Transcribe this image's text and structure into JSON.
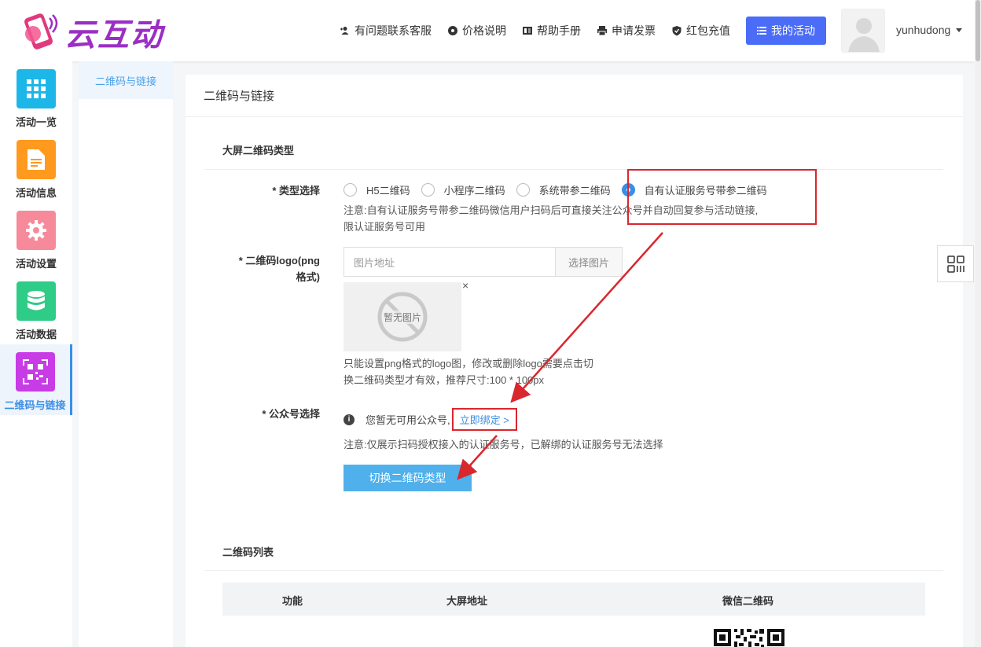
{
  "header": {
    "logo_text": "云互动",
    "nav": [
      {
        "label": "有问题联系客服",
        "icon": "user-plus-icon"
      },
      {
        "label": "价格说明",
        "icon": "gear-badge-icon"
      },
      {
        "label": "帮助手册",
        "icon": "book-icon"
      },
      {
        "label": "申请发票",
        "icon": "printer-icon"
      },
      {
        "label": "红包充值",
        "icon": "shield-check-icon"
      }
    ],
    "my_activity": "我的活动",
    "username": "yunhudong"
  },
  "sidebar": {
    "items": [
      {
        "label": "活动一览",
        "color": "#1cb7e8",
        "icon": "grid-icon"
      },
      {
        "label": "活动信息",
        "color": "#ff9a1f",
        "icon": "document-icon"
      },
      {
        "label": "活动设置",
        "color": "#f78a9a",
        "icon": "gear-icon"
      },
      {
        "label": "活动数据",
        "color": "#2ecc87",
        "icon": "database-icon"
      },
      {
        "label": "二维码与链接",
        "color": "#c83ce6",
        "icon": "qrcode-icon",
        "active": true
      }
    ]
  },
  "submenu": {
    "active": "二维码与链接"
  },
  "panel": {
    "title": "二维码与链接",
    "section1": "大屏二维码类型",
    "type_label": "* 类型选择",
    "radios": [
      {
        "label": "H5二维码",
        "checked": false
      },
      {
        "label": "小程序二维码",
        "checked": false
      },
      {
        "label": "系统带参二维码",
        "checked": false
      },
      {
        "label": "自有认证服务号带参二维码",
        "checked": true
      }
    ],
    "type_note_1": "注意:自有认证服务号带参二维码微信用户扫码后可直接关注公众号并自动回复参与活动链接,",
    "type_note_2": "限认证服务号可用",
    "logo_label_1": "* 二维码logo(png",
    "logo_label_2": "格式)",
    "logo_placeholder": "图片地址",
    "choose_image": "选择图片",
    "no_image": "暂无图片",
    "close": "×",
    "logo_note_1": "只能设置png格式的logo图，修改或删除logo需要点击切",
    "logo_note_2": "换二维码类型才有效，推荐尺寸:100 * 100px",
    "account_label": "* 公众号选择",
    "no_account": "您暂无可用公众号,",
    "bind_now": "立即绑定 >",
    "account_note": "注意:仅展示扫码授权接入的认证服务号，已解绑的认证服务号无法选择",
    "switch_button": "切换二维码类型",
    "section2": "二维码列表",
    "table_headers": [
      "功能",
      "大屏地址",
      "微信二维码"
    ]
  }
}
